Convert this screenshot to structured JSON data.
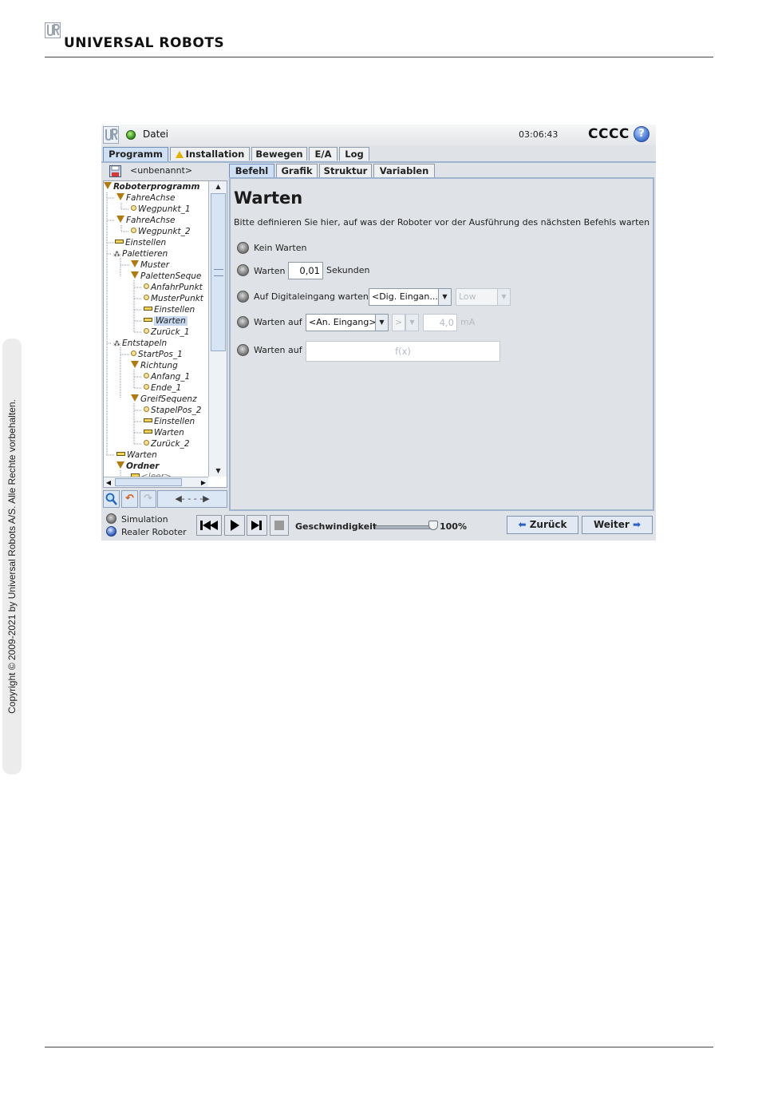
{
  "page": {
    "brand": "UNIVERSAL ROBOTS",
    "copyright": "Copyright © 2009-2021 by Universal Robots A/S. Alle Rechte vorbehalten."
  },
  "titlebar": {
    "menu": "Datei",
    "time": "03:06:43",
    "robot_name": "CCCC",
    "help_icon": "?"
  },
  "main_tabs": [
    {
      "label": "Programm",
      "active": true
    },
    {
      "label": "Installation",
      "warning": true
    },
    {
      "label": "Bewegen"
    },
    {
      "label": "E/A"
    },
    {
      "label": "Log"
    }
  ],
  "program": {
    "name": "<unbenannt>",
    "tree": [
      {
        "label": "Roboterprogramm",
        "icon": "triangle-icon"
      },
      {
        "label": "FahreAchse",
        "icon": "triangle-icon"
      },
      {
        "label": "Wegpunkt_1",
        "icon": "dot-icon"
      },
      {
        "label": "FahreAchse",
        "icon": "triangle-icon"
      },
      {
        "label": "Wegpunkt_2",
        "icon": "dot-icon"
      },
      {
        "label": "Einstellen",
        "icon": "bar-icon"
      },
      {
        "label": "Palettieren",
        "icon": "pallet-icon"
      },
      {
        "label": "Muster",
        "icon": "triangle-icon"
      },
      {
        "label": "PalettenSeque",
        "icon": "triangle-icon"
      },
      {
        "label": "AnfahrPunkt",
        "icon": "dot-icon"
      },
      {
        "label": "MusterPunkt",
        "icon": "dot-icon"
      },
      {
        "label": "Einstellen",
        "icon": "bar-icon"
      },
      {
        "label": "Warten",
        "icon": "bar-icon",
        "selected": true
      },
      {
        "label": "Zurück_1",
        "icon": "dot-icon"
      },
      {
        "label": "Entstapeln",
        "icon": "pallet-icon"
      },
      {
        "label": "StartPos_1",
        "icon": "dot-icon"
      },
      {
        "label": "Richtung",
        "icon": "triangle-icon"
      },
      {
        "label": "Anfang_1",
        "icon": "dot-icon"
      },
      {
        "label": "Ende_1",
        "icon": "dot-icon"
      },
      {
        "label": "GreifSequenz",
        "icon": "triangle-icon"
      },
      {
        "label": "StapelPos_2",
        "icon": "dot-icon"
      },
      {
        "label": "Einstellen",
        "icon": "bar-icon"
      },
      {
        "label": "Warten",
        "icon": "bar-icon"
      },
      {
        "label": "Zurück_2",
        "icon": "dot-icon"
      },
      {
        "label": "Warten",
        "icon": "bar-icon"
      },
      {
        "label": "Ordner",
        "icon": "triangle-icon"
      },
      {
        "label": "<leer>",
        "icon": "bar-icon"
      }
    ]
  },
  "sub_tabs": [
    {
      "label": "Befehl",
      "active": true
    },
    {
      "label": "Grafik"
    },
    {
      "label": "Struktur"
    },
    {
      "label": "Variablen"
    }
  ],
  "command": {
    "title": "Warten",
    "description": "Bitte definieren Sie hier, auf was der Roboter vor der Ausführung des nächsten Befehls warten s",
    "option_no_wait": "Kein Warten",
    "option_wait": "Warten",
    "wait_value": "0,01",
    "wait_unit": "Sekunden",
    "option_digital": "Auf Digitaleingang warten",
    "digital_input": "<Dig. Eingan...",
    "digital_level": "Low",
    "option_analog": "Warten auf",
    "analog_input": "<An. Eingang>",
    "analog_operator": ">",
    "analog_value": "4,0",
    "analog_unit": "mA",
    "option_expression": "Warten auf",
    "expression_placeholder": "f(x)"
  },
  "footer": {
    "mode_simulation": "Simulation",
    "mode_real": "Realer Roboter",
    "speed_label": "Geschwindigkeit",
    "speed_value": "100%",
    "speed_fraction": 1.0,
    "back_label": "Zurück",
    "next_label": "Weiter"
  },
  "colors": {
    "active_tab": "#cfe0f5",
    "window_bg": "#dfe2e6",
    "accent_blue": "#2a62c8",
    "status_led": "#2f8a1b"
  }
}
